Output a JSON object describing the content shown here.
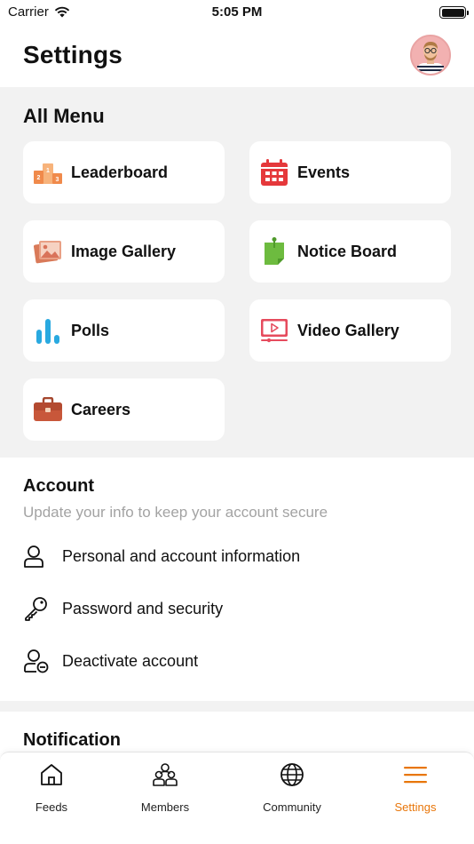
{
  "status_bar": {
    "carrier": "Carrier",
    "time": "5:05 PM"
  },
  "header": {
    "title": "Settings"
  },
  "all_menu": {
    "title": "All Menu",
    "items": [
      {
        "label": "Leaderboard",
        "icon": "podium-icon"
      },
      {
        "label": "Events",
        "icon": "calendar-icon"
      },
      {
        "label": "Image Gallery",
        "icon": "image-gallery-icon"
      },
      {
        "label": "Notice Board",
        "icon": "notice-board-icon"
      },
      {
        "label": "Polls",
        "icon": "poll-bars-icon"
      },
      {
        "label": "Video Gallery",
        "icon": "video-gallery-icon"
      },
      {
        "label": "Careers",
        "icon": "briefcase-icon"
      }
    ]
  },
  "account": {
    "title": "Account",
    "subtitle": "Update your info to keep your account secure",
    "items": [
      {
        "label": "Personal and account information",
        "icon": "user-icon"
      },
      {
        "label": "Password and security",
        "icon": "key-icon"
      },
      {
        "label": "Deactivate account",
        "icon": "user-remove-icon"
      }
    ]
  },
  "notification": {
    "title": "Notification"
  },
  "tabs": [
    {
      "label": "Feeds",
      "icon": "home-icon",
      "active": false
    },
    {
      "label": "Members",
      "icon": "members-icon",
      "active": false
    },
    {
      "label": "Community",
      "icon": "globe-icon",
      "active": false
    },
    {
      "label": "Settings",
      "icon": "menu-icon",
      "active": true
    }
  ],
  "colors": {
    "accent": "#e8760a",
    "section_bg": "#f2f2f2",
    "subtitle": "#a3a3a3"
  }
}
